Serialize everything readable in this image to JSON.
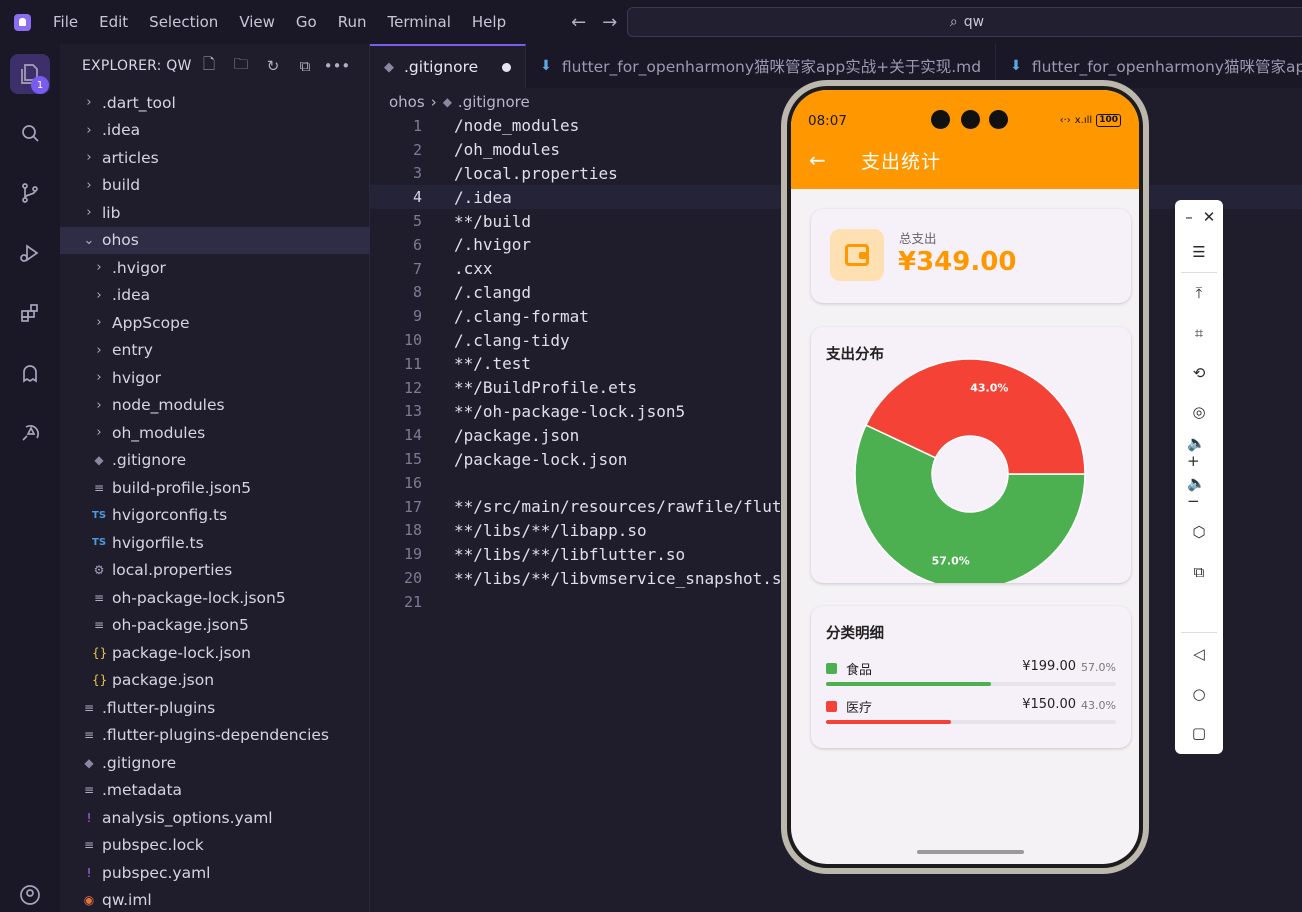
{
  "menubar": {
    "items": [
      "File",
      "Edit",
      "Selection",
      "View",
      "Go",
      "Run",
      "Terminal",
      "Help"
    ],
    "search": "qw"
  },
  "activity": {
    "badge": "1"
  },
  "sidebar": {
    "title": "EXPLORER: QW",
    "tree": [
      {
        "label": ".dart_tool",
        "type": "folder",
        "indent": 0
      },
      {
        "label": ".idea",
        "type": "folder",
        "indent": 0
      },
      {
        "label": "articles",
        "type": "folder",
        "indent": 0
      },
      {
        "label": "build",
        "type": "folder",
        "indent": 0
      },
      {
        "label": "lib",
        "type": "folder",
        "indent": 0
      },
      {
        "label": "ohos",
        "type": "folder-open",
        "indent": 0,
        "selected": true
      },
      {
        "label": ".hvigor",
        "type": "folder",
        "indent": 1
      },
      {
        "label": ".idea",
        "type": "folder",
        "indent": 1
      },
      {
        "label": "AppScope",
        "type": "folder",
        "indent": 1
      },
      {
        "label": "entry",
        "type": "folder",
        "indent": 1
      },
      {
        "label": "hvigor",
        "type": "folder",
        "indent": 1
      },
      {
        "label": "node_modules",
        "type": "folder",
        "indent": 1
      },
      {
        "label": "oh_modules",
        "type": "folder",
        "indent": 1
      },
      {
        "label": ".gitignore",
        "type": "git",
        "indent": 1
      },
      {
        "label": "build-profile.json5",
        "type": "lines",
        "indent": 1
      },
      {
        "label": "hvigorconfig.ts",
        "type": "ts",
        "indent": 1
      },
      {
        "label": "hvigorfile.ts",
        "type": "ts",
        "indent": 1
      },
      {
        "label": "local.properties",
        "type": "gear",
        "indent": 1
      },
      {
        "label": "oh-package-lock.json5",
        "type": "lines",
        "indent": 1
      },
      {
        "label": "oh-package.json5",
        "type": "lines",
        "indent": 1
      },
      {
        "label": "package-lock.json",
        "type": "json",
        "indent": 1
      },
      {
        "label": "package.json",
        "type": "json",
        "indent": 1
      },
      {
        "label": ".flutter-plugins",
        "type": "lines",
        "indent": 0
      },
      {
        "label": ".flutter-plugins-dependencies",
        "type": "lines",
        "indent": 0
      },
      {
        "label": ".gitignore",
        "type": "git",
        "indent": 0
      },
      {
        "label": ".metadata",
        "type": "lines",
        "indent": 0
      },
      {
        "label": "analysis_options.yaml",
        "type": "yaml",
        "indent": 0
      },
      {
        "label": "pubspec.lock",
        "type": "lines",
        "indent": 0
      },
      {
        "label": "pubspec.yaml",
        "type": "yaml",
        "indent": 0
      },
      {
        "label": "qw.iml",
        "type": "rss",
        "indent": 0
      }
    ]
  },
  "editor": {
    "tabs": [
      {
        "label": ".gitignore",
        "active": true,
        "modified": true
      },
      {
        "label": "flutter_for_openharmony猫咪管家app实战+关于实现.md",
        "active": false
      },
      {
        "label": "flutter_for_openharmony猫咪管家app",
        "active": false
      }
    ],
    "breadcrumb": {
      "folder": "ohos",
      "file": ".gitignore"
    },
    "current_line": 4,
    "lines": [
      "/node_modules",
      "/oh_modules",
      "/local.properties",
      "/.idea",
      "**/build",
      "/.hvigor",
      ".cxx",
      "/.clangd",
      "/.clang-format",
      "/.clang-tidy",
      "**/.test",
      "**/BuildProfile.ets",
      "**/oh-package-lock.json5",
      "/package.json",
      "/package-lock.json",
      "",
      "**/src/main/resources/rawfile/flut",
      "**/libs/**/libapp.so",
      "**/libs/**/libflutter.so",
      "**/libs/**/libvmservice_snapshot.s",
      ""
    ]
  },
  "phone": {
    "time": "08:07",
    "battery": "100",
    "signal": "x.ıll",
    "title": "支出统计",
    "total_label": "总支出",
    "total_value": "¥349.00",
    "distribution_title": "支出分布",
    "detail_title": "分类明细",
    "colors": {
      "header": "#ff9800",
      "food": "#4caf50",
      "medical": "#f44336"
    },
    "details": [
      {
        "name": "食品",
        "amount": "¥199.00",
        "percent": "57.0%",
        "fraction": 0.57,
        "color": "#4caf50"
      },
      {
        "name": "医疗",
        "amount": "¥150.00",
        "percent": "43.0%",
        "fraction": 0.43,
        "color": "#f44336"
      }
    ]
  },
  "chart_data": {
    "type": "pie",
    "title": "支出分布",
    "categories": [
      "食品",
      "医疗"
    ],
    "values": [
      57.0,
      43.0
    ],
    "labels": [
      "57.0%",
      "43.0%"
    ],
    "colors": [
      "#4caf50",
      "#f44336"
    ],
    "donut": true
  },
  "toolbar": {
    "icons": [
      "minimize-icon",
      "close-icon",
      "menu-icon",
      "pin-top-icon",
      "crop-icon",
      "rotate-icon",
      "screenshot-icon",
      "volume-up-icon",
      "volume-down-icon",
      "shake-icon",
      "multi-screen-icon",
      "back-icon",
      "home-icon",
      "recent-icon"
    ]
  }
}
